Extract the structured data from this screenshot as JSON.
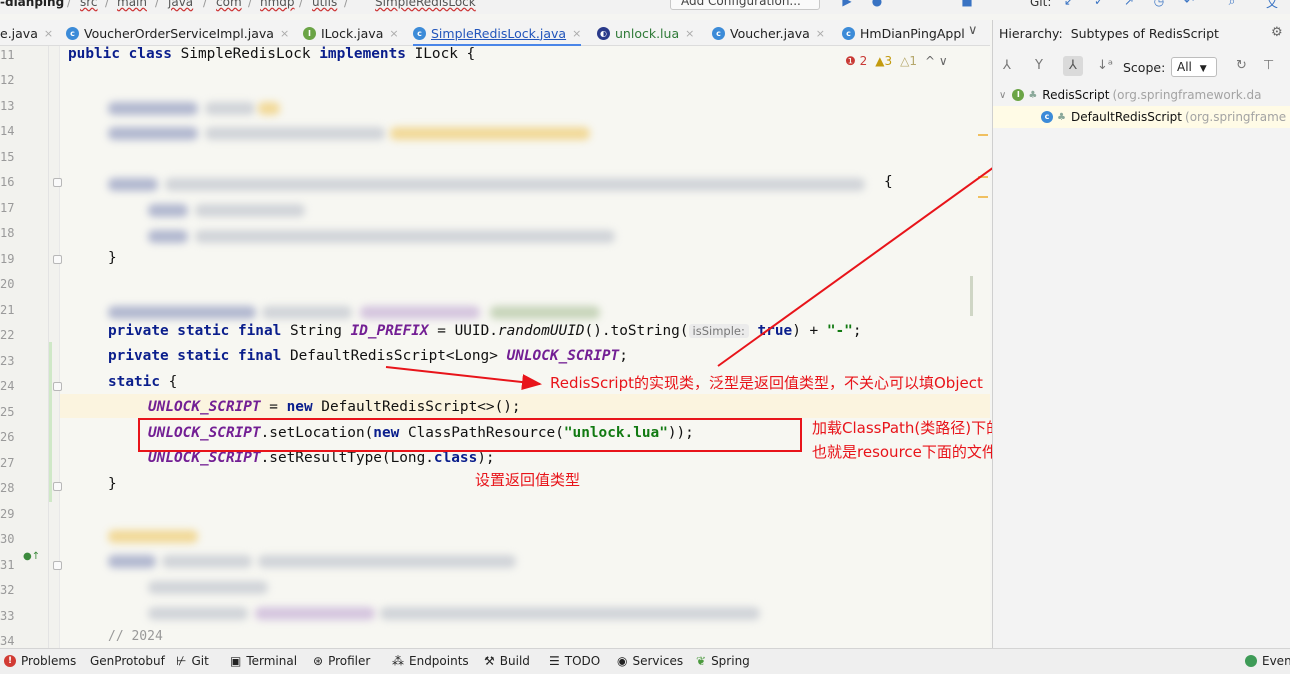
{
  "breadcrumb": {
    "items": [
      "-dianping",
      "src",
      "main",
      "java",
      "com",
      "hmdp",
      "utils",
      "SimpleRedisLock"
    ],
    "separator": "/",
    "run_config": "Add Configuration...",
    "git_label": "Git:"
  },
  "tabs": [
    {
      "label": "e.java",
      "icon": "c"
    },
    {
      "label": "VoucherOrderServiceImpl.java",
      "icon": "c"
    },
    {
      "label": "ILock.java",
      "icon": "i"
    },
    {
      "label": "SimpleRedisLock.java",
      "icon": "c",
      "active": true
    },
    {
      "label": "unlock.lua",
      "icon": "lua"
    },
    {
      "label": "Voucher.java",
      "icon": "c"
    },
    {
      "label": "HmDianPingAppl",
      "icon": "c"
    }
  ],
  "tab_close": "×",
  "tab_overflow": "∨",
  "inspections": {
    "errors": "2",
    "warnings": "3",
    "weak": "1",
    "nav": "^ ∨"
  },
  "line_numbers": [
    "11",
    "12",
    "13",
    "14",
    "15",
    "16",
    "17",
    "18",
    "19",
    "20",
    "21",
    "22",
    "23",
    "24",
    "25",
    "26",
    "27",
    "28",
    "29",
    "30",
    "31",
    "32",
    "33",
    "34"
  ],
  "code": {
    "l11_kw1": "public class ",
    "l11_name": "SimpleRedisLock ",
    "l11_kw2": "implements ",
    "l11_rest": "ILock {",
    "l16_brace": "{",
    "l19": "}",
    "l22_kw": "private static final ",
    "l22_type": "String ",
    "l22_field": "ID_PREFIX",
    "l22_eq": " = UUID.",
    "l22_call": "randomUUID",
    "l22_rest": "().toString(",
    "l22_hint": "isSimple:",
    "l22_true": " true",
    "l22_plus": ") + ",
    "l22_str": "\"-\"",
    "l22_end": ";",
    "l23_kw": "private static final ",
    "l23_type": "DefaultRedisScript<Long> ",
    "l23_field": "UNLOCK_SCRIPT",
    "l23_end": ";",
    "l24_kw": "static ",
    "l24_brace": "{",
    "l25_field": "UNLOCK_SCRIPT",
    "l25_eq": " = ",
    "l25_kw": "new ",
    "l25_rest": "DefaultRedisScript<>();",
    "l26_field": "UNLOCK_SCRIPT",
    "l26_mid": ".setLocation(",
    "l26_kw": "new ",
    "l26_cls": "ClassPathResource(",
    "l26_str": "\"unlock.lua\"",
    "l26_end": "));",
    "l27_field": "UNLOCK_SCRIPT",
    "l27_mid": ".setResultType(Long.",
    "l27_kw": "class",
    "l27_end": ");",
    "l28": "}",
    "l34": "// 2024"
  },
  "annotations": {
    "impl_note": "RedisScript的实现类，泛型是返回值类型，不关心可以填Object",
    "classpath_note_1": "加载ClassPath(类路径)下的文件,",
    "classpath_note_2": "也就是resource下面的文件",
    "result_note": "设置返回值类型",
    "color": "#e8141a"
  },
  "hierarchy": {
    "title": "Hierarchy:",
    "subtitle": "Subtypes of RedisScript",
    "scope_label": "Scope:",
    "scope_value": "All",
    "tree": [
      {
        "name": "RedisScript",
        "pkg": "(org.springframework.da"
      },
      {
        "name": "DefaultRedisScript",
        "pkg": "(org.springframe"
      }
    ]
  },
  "bottom_bar": [
    {
      "label": "Problems",
      "icon": "error-icon"
    },
    {
      "label": "GenProtobuf",
      "icon": ""
    },
    {
      "label": "Git",
      "icon": "git-branch-icon"
    },
    {
      "label": "Terminal",
      "icon": "terminal-icon"
    },
    {
      "label": "Profiler",
      "icon": "profiler-icon"
    },
    {
      "label": "Endpoints",
      "icon": "endpoints-icon"
    },
    {
      "label": "Build",
      "icon": "hammer-icon"
    },
    {
      "label": "TODO",
      "icon": "list-icon"
    },
    {
      "label": "Services",
      "icon": "services-icon"
    },
    {
      "label": "Spring",
      "icon": "leaf-icon"
    },
    {
      "label": "Even",
      "icon": "event-log-icon"
    }
  ]
}
